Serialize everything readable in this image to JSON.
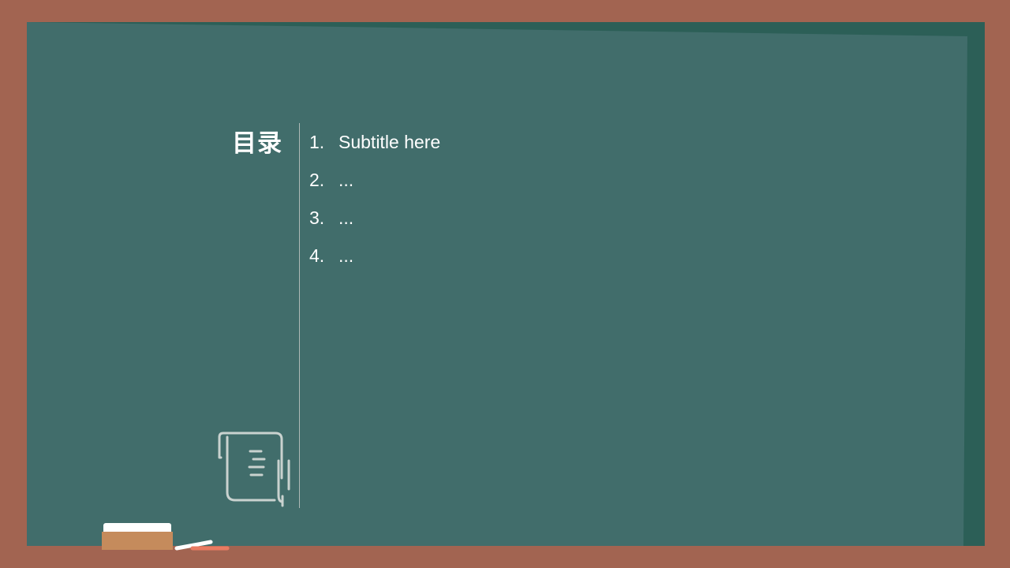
{
  "slide": {
    "title": "目录",
    "toc_items": [
      {
        "number": "1.",
        "text": "Subtitle here"
      },
      {
        "number": "2.",
        "text": "..."
      },
      {
        "number": "3.",
        "text": "..."
      },
      {
        "number": "4.",
        "text": "..."
      }
    ],
    "icons": {
      "document": "scroll-document-icon",
      "eraser": "chalkboard-eraser-icon",
      "chalk": "chalk-sticks-icon"
    }
  },
  "colors": {
    "frame": "#a26451",
    "board": "#416d6b",
    "board_shadow": "#2c5f57",
    "text": "#ffffff",
    "divider": "#aeb9b6"
  }
}
